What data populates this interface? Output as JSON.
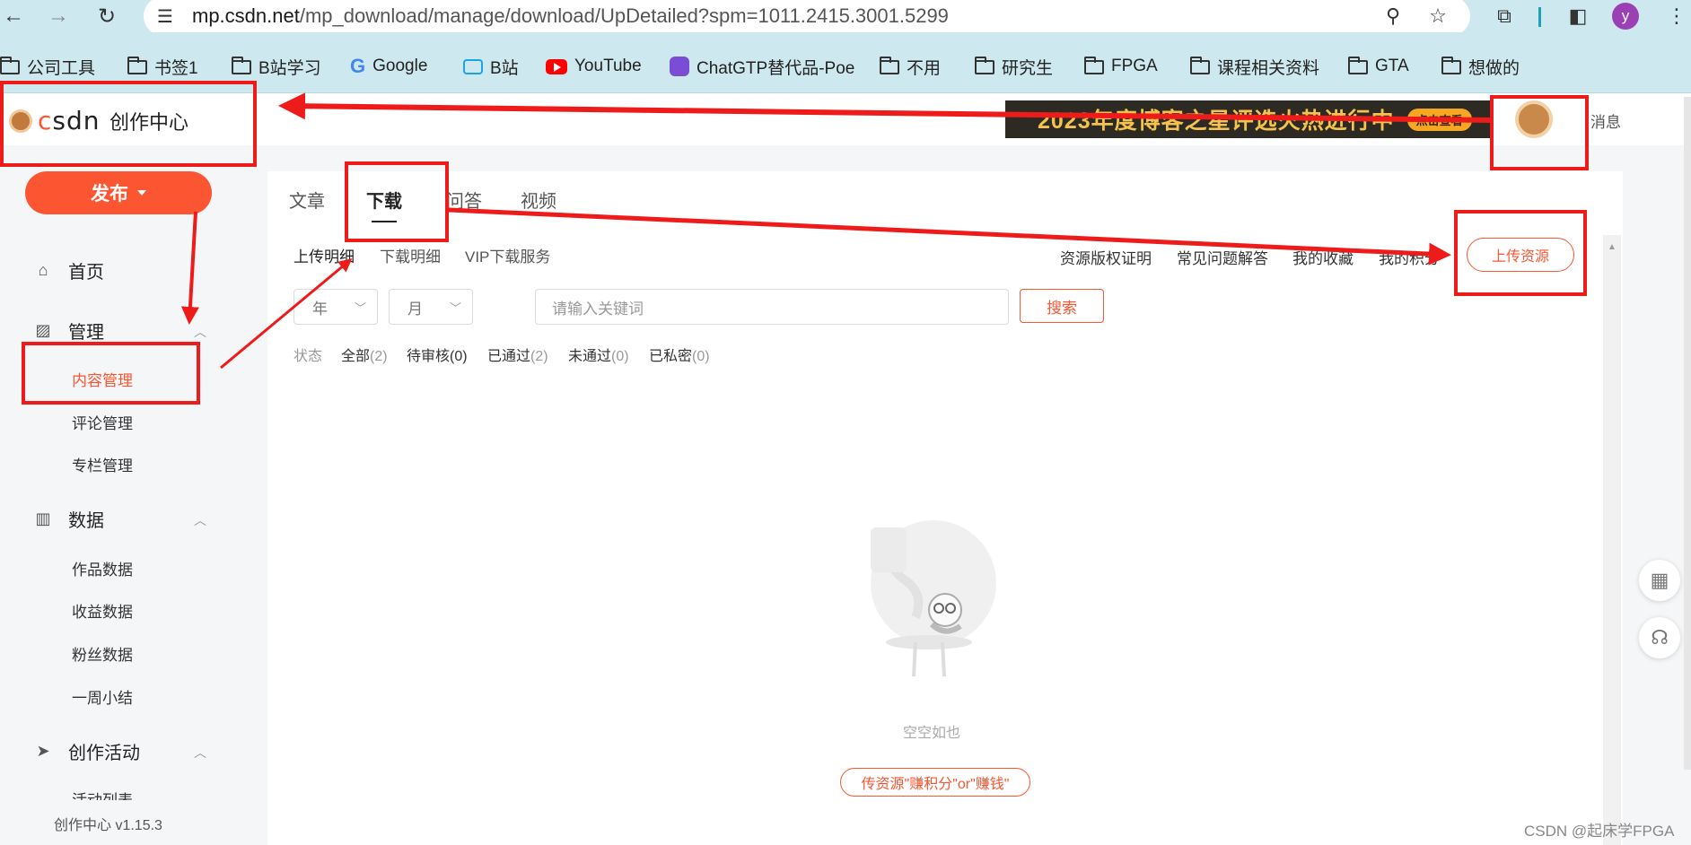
{
  "browser": {
    "url_host": "mp.csdn.net",
    "url_path": "/mp_download/manage/download/UpDetailed?spm=1011.2415.3001.5299",
    "profile_initial": "y",
    "bookmarks": [
      {
        "label": "公司工具",
        "icon": "folder-icon"
      },
      {
        "label": "书签1",
        "icon": "folder-icon"
      },
      {
        "label": "B站学习",
        "icon": "folder-icon"
      },
      {
        "label": "Google",
        "icon": "google-icon"
      },
      {
        "label": "B站",
        "icon": "bilibili-icon"
      },
      {
        "label": "YouTube",
        "icon": "youtube-icon"
      },
      {
        "label": "ChatGTP替代品-Poe",
        "icon": "poe-icon"
      },
      {
        "label": "不用",
        "icon": "folder-icon"
      },
      {
        "label": "研究生",
        "icon": "folder-icon"
      },
      {
        "label": "FPGA",
        "icon": "folder-icon"
      },
      {
        "label": "课程相关资料",
        "icon": "folder-icon"
      },
      {
        "label": "GTA",
        "icon": "folder-icon"
      },
      {
        "label": "想做的",
        "icon": "folder-icon"
      }
    ]
  },
  "header": {
    "logo_text": "csdn",
    "title": "创作中心",
    "banner_text": "2023年度博客之星评选火热进行中",
    "banner_button": "点击查看",
    "messages": "消息"
  },
  "sidebar": {
    "publish": "发布",
    "home": "首页",
    "manage": "管理",
    "manage_items": [
      "内容管理",
      "评论管理",
      "专栏管理"
    ],
    "data": "数据",
    "data_items": [
      "作品数据",
      "收益数据",
      "粉丝数据",
      "一周小结"
    ],
    "activity": "创作活动",
    "activity_items": [
      "活动列表"
    ],
    "version": "创作中心 v1.15.3"
  },
  "main": {
    "tabs": [
      "文章",
      "下载",
      "问答",
      "视频"
    ],
    "active_tab": "下载",
    "subtabs": [
      "上传明细",
      "下载明细",
      "VIP下载服务"
    ],
    "right_links": [
      "资源版权证明",
      "常见问题解答",
      "我的收藏",
      "我的积分"
    ],
    "upload_button": "上传资源",
    "year_select": "年",
    "month_select": "月",
    "keyword_placeholder": "请输入关键词",
    "search_button": "搜索",
    "status_label": "状态",
    "statuses": [
      {
        "label": "全部",
        "count": "(2)"
      },
      {
        "label": "待审核",
        "count": "(0)"
      },
      {
        "label": "已通过",
        "count": "(2)"
      },
      {
        "label": "未通过",
        "count": "(0)"
      },
      {
        "label": "已私密",
        "count": "(0)"
      }
    ],
    "empty_text": "空空如也",
    "cta_button": "传资源\"赚积分\"or\"赚钱\""
  },
  "watermark": "CSDN @起床学FPGA",
  "colors": {
    "accent": "#fc5531",
    "annotation": "#ee1b1b",
    "chrome": "#cde8ee"
  }
}
